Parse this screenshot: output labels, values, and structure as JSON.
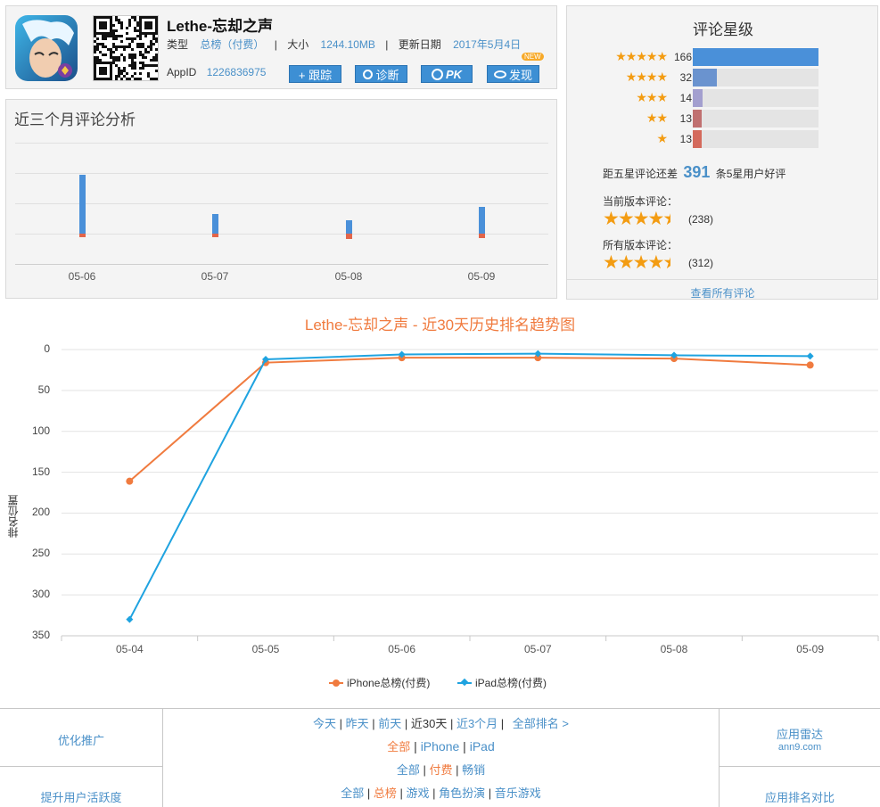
{
  "app": {
    "name": "Lethe-忘却之声",
    "type_label": "类型",
    "type_value": "总榜（付费）",
    "size_label": "大小",
    "size_value": "1244.10MB",
    "update_label": "更新日期",
    "update_value": "2017年5月4日",
    "appid_label": "AppID",
    "appid_value": "1226836975",
    "buttons": [
      {
        "label": "+ 跟踪",
        "icon": "plus-icon"
      },
      {
        "label": "诊断",
        "icon": "magnifier-icon"
      },
      {
        "label": "PK",
        "icon": "pk-icon"
      },
      {
        "label": "发现",
        "icon": "eye-icon"
      }
    ],
    "new_badge": "NEW"
  },
  "review_analysis": {
    "title": "近三个月评论分析",
    "dates": [
      "05-06",
      "05-07",
      "05-08",
      "05-09"
    ],
    "positive": [
      66,
      22,
      15,
      30
    ],
    "negative": [
      4,
      4,
      6,
      5
    ],
    "colors": {
      "positive": "#4a90d9",
      "negative": "#e2654a"
    }
  },
  "ratings": {
    "title": "评论星级",
    "rows": [
      {
        "stars": "★★★★★",
        "count": "166",
        "fraction": 1.0,
        "color": "#4a90d9"
      },
      {
        "stars": "★★★★",
        "count": "32",
        "fraction": 0.19,
        "color": "#6a93cf"
      },
      {
        "stars": "★★★",
        "count": "14",
        "fraction": 0.08,
        "color": "#a39fcf"
      },
      {
        "stars": "★★",
        "count": "13",
        "fraction": 0.07,
        "color": "#c07070"
      },
      {
        "stars": "★",
        "count": "13",
        "fraction": 0.07,
        "color": "#d46a5c"
      }
    ],
    "gap_prefix": "距五星评论还差",
    "gap_number": "391",
    "gap_suffix": "条5星用户好评",
    "current_label": "当前版本评论：",
    "current_count": "(238)",
    "current_rating": 4.5,
    "all_label": "所有版本评论：",
    "all_count": "(312)",
    "all_rating": 4.5,
    "view_all": "查看所有评论"
  },
  "chart_data": {
    "type": "line",
    "title": "Lethe-忘却之声 - 近30天历史排名趋势图",
    "ylabel": "排名位置",
    "xlabel": "",
    "x": [
      "05-04",
      "05-05",
      "05-06",
      "05-07",
      "05-08",
      "05-09"
    ],
    "ylim": [
      0,
      350
    ],
    "y_reversed": true,
    "yticks": [
      0,
      50,
      100,
      150,
      200,
      250,
      300,
      350
    ],
    "grid": true,
    "legend_position": "bottom",
    "series": [
      {
        "name": "iPhone总榜(付费)",
        "color": "#f07b3f",
        "marker": "circle",
        "values": [
          161,
          16,
          10,
          10,
          11,
          19
        ]
      },
      {
        "name": "iPad总榜(付费)",
        "color": "#1fa3e0",
        "marker": "diamond",
        "values": [
          330,
          12,
          6,
          5,
          7,
          8
        ]
      }
    ]
  },
  "nav": {
    "left_top": "优化推广",
    "left_bottom": "提升用户活跃度",
    "right_top": "应用雷达",
    "right_top_sub": "ann9.com",
    "right_bottom": "应用排名对比",
    "row1": [
      "今天",
      "昨天",
      "前天",
      "近30天",
      "近3个月",
      "全部排名 >"
    ],
    "row2": [
      "全部",
      "iPhone",
      "iPad"
    ],
    "row3": [
      "全部",
      "付费",
      "畅销"
    ],
    "row4": [
      "全部",
      "总榜",
      "游戏",
      "角色扮演",
      "音乐游戏"
    ]
  }
}
